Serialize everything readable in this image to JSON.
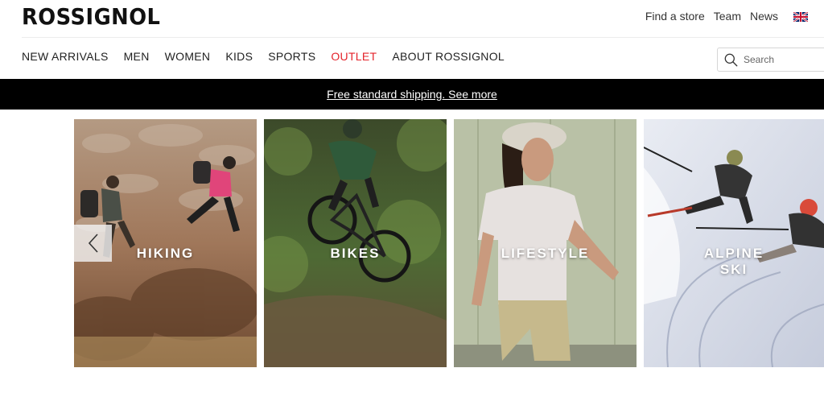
{
  "brand": {
    "logo_text": "ROSSIGNOL"
  },
  "utility_nav": {
    "find_store": "Find a store",
    "team": "Team",
    "news": "News",
    "language_icon": "uk-flag-icon"
  },
  "main_nav": {
    "items": [
      "NEW ARRIVALS",
      "MEN",
      "WOMEN",
      "KIDS",
      "SPORTS",
      "OUTLET",
      "ABOUT ROSSIGNOL"
    ],
    "highlight_color": "#e4232b"
  },
  "search": {
    "placeholder": "Search",
    "icon": "search-icon"
  },
  "promo": {
    "text": "Free standard shipping. See more",
    "background": "#000000"
  },
  "carousel": {
    "prev_icon": "chevron-left-icon",
    "cards": [
      {
        "label": "HIKING"
      },
      {
        "label": "BIKES"
      },
      {
        "label": "LIFESTYLE"
      },
      {
        "label_line1": "ALPINE",
        "label_line2": "SKI"
      }
    ]
  }
}
